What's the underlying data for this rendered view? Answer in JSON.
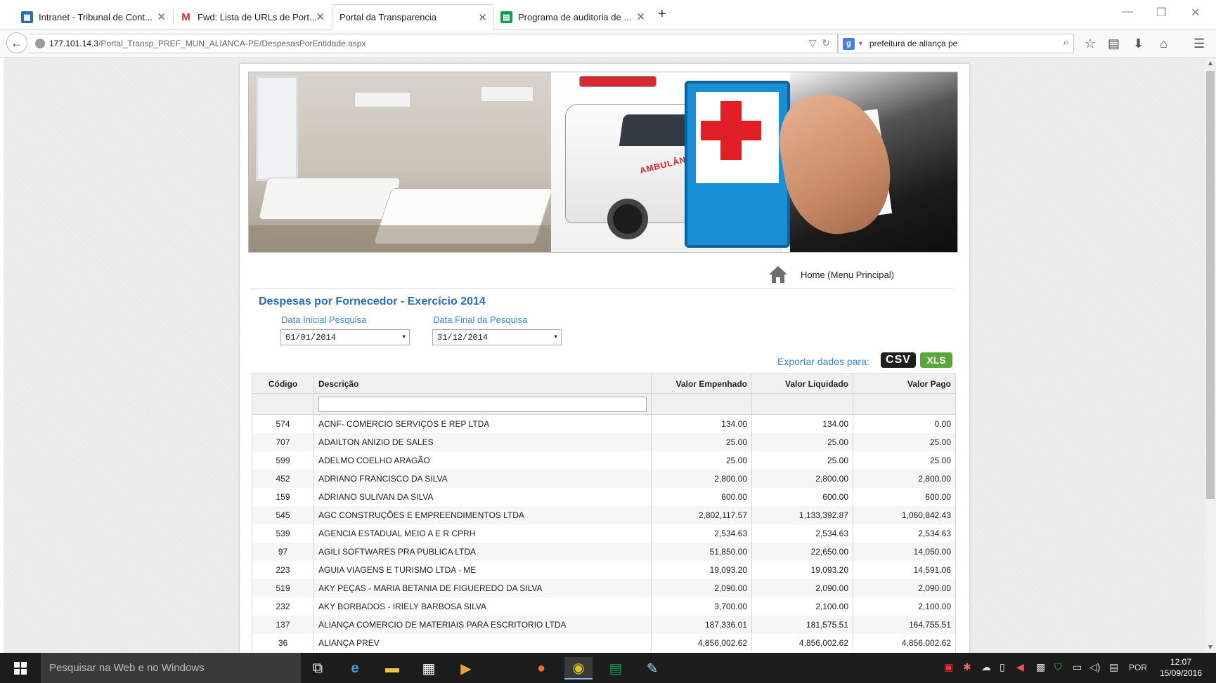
{
  "browser": {
    "tabs": [
      {
        "label": "Intranet - Tribunal de Cont...",
        "icon": "intranet-favicon"
      },
      {
        "label": "Fwd: Lista de URLs de Port...",
        "icon": "gmail-favicon"
      },
      {
        "label": "Portal da Transparencia",
        "icon": "none",
        "active": true
      },
      {
        "label": "Programa de auditoria de ...",
        "icon": "sheets-favicon"
      }
    ],
    "url_host": "177.101.14.3",
    "url_path": "/Portal_Transp_PREF_MUN_ALIANCA-PE/DespesasPorEntidade.aspx",
    "search_text": "prefeitura de aliança pe"
  },
  "banner": {
    "ambulance_text": "AMBULÂNCIA"
  },
  "home_link_label": "Home (Menu Principal)",
  "page_title": "Despesas por Fornecedor - Exercício 2014",
  "filters": {
    "start_label": "Data Inicial Pesquisa",
    "start_value": "01/01/2014",
    "end_label": "Data Final da Pesquisa",
    "end_value": "31/12/2014"
  },
  "export": {
    "label": "Exportar dados para:",
    "csv": "CSV",
    "xls": "XLS",
    "csv_color": "#1e1e1e",
    "xls_color": "#5aa53c"
  },
  "table": {
    "headers": {
      "code": "Código",
      "desc": "Descrição",
      "empenhado": "Valor Empenhado",
      "liquidado": "Valor Liquidado",
      "pago": "Valor Pago"
    },
    "rows": [
      {
        "code": "574",
        "desc": "ACNF- COMERCIO SERVIÇOS E REP LTDA",
        "empenhado": "134.00",
        "liquidado": "134.00",
        "pago": "0.00"
      },
      {
        "code": "707",
        "desc": "ADAILTON ANIZIO DE SALES",
        "empenhado": "25.00",
        "liquidado": "25.00",
        "pago": "25.00"
      },
      {
        "code": "599",
        "desc": "ADELMO COELHO ARAGÃO",
        "empenhado": "25.00",
        "liquidado": "25.00",
        "pago": "25.00"
      },
      {
        "code": "452",
        "desc": "ADRIANO FRANCISCO DA SILVA",
        "empenhado": "2,800.00",
        "liquidado": "2,800.00",
        "pago": "2,800.00"
      },
      {
        "code": "159",
        "desc": "ADRIANO SULIVAN DA SILVA",
        "empenhado": "600.00",
        "liquidado": "600.00",
        "pago": "600.00"
      },
      {
        "code": "545",
        "desc": "AGC CONSTRUÇÕES E EMPREENDIMENTOS LTDA",
        "empenhado": "2,802,117.57",
        "liquidado": "1,133,392.87",
        "pago": "1,060,842.43"
      },
      {
        "code": "539",
        "desc": "AGENCIA ESTADUAL MEIO A E R CPRH",
        "empenhado": "2,534.63",
        "liquidado": "2,534.63",
        "pago": "2,534.63"
      },
      {
        "code": "97",
        "desc": "AGILI SOFTWARES PRA PUBLICA LTDA",
        "empenhado": "51,850.00",
        "liquidado": "22,650.00",
        "pago": "14,050.00"
      },
      {
        "code": "223",
        "desc": "AGUIA VIAGENS E TURISMO LTDA - ME",
        "empenhado": "19,093.20",
        "liquidado": "19,093.20",
        "pago": "14,591.06"
      },
      {
        "code": "519",
        "desc": "AKY PEÇAS - MARIA BETANIA DE FIGUEREDO DA SILVA",
        "empenhado": "2,090.00",
        "liquidado": "2,090.00",
        "pago": "2,090.00"
      },
      {
        "code": "232",
        "desc": "AKY BORBADOS - IRIELY BARBOSA SILVA",
        "empenhado": "3,700.00",
        "liquidado": "2,100.00",
        "pago": "2,100.00"
      },
      {
        "code": "137",
        "desc": "ALIANÇA COMERCIO DE MATERIAIS PARA ESCRITORIO LTDA",
        "empenhado": "187,336.01",
        "liquidado": "181,575.51",
        "pago": "164,755.51"
      },
      {
        "code": "36",
        "desc": "ALIANÇA PREV",
        "empenhado": "4,856,002.62",
        "liquidado": "4,856,002.62",
        "pago": "4,856,002.62"
      }
    ]
  },
  "taskbar": {
    "search_placeholder": "Pesquisar na Web e no Windows",
    "language": "POR",
    "time": "12:07",
    "date": "15/09/2016"
  }
}
